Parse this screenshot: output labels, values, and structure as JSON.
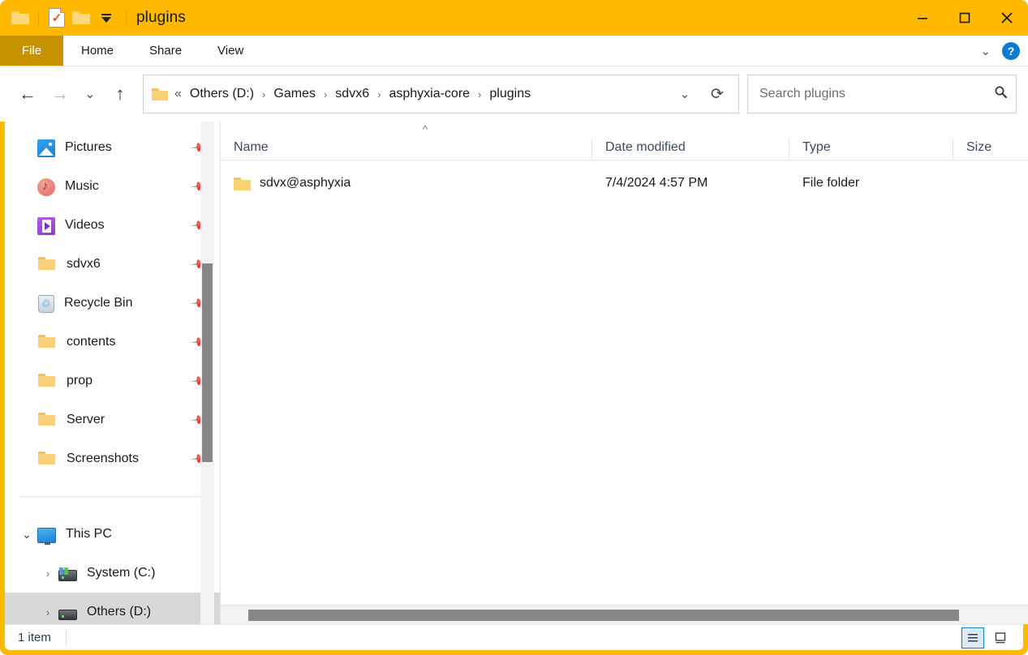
{
  "window": {
    "title": "plugins",
    "controls": {
      "minimize": "minimize-button",
      "maximize": "maximize-button",
      "close": "close-button"
    },
    "accent_color": "#FFB900",
    "file_tab_color": "#C69200"
  },
  "quick_access": {
    "items": [
      {
        "name": "folder-icon",
        "label": ""
      },
      {
        "name": "properties-icon",
        "label": ""
      },
      {
        "name": "new-folder-icon",
        "label": ""
      },
      {
        "name": "customize-dropdown",
        "label": ""
      }
    ]
  },
  "ribbon": {
    "tabs": [
      {
        "label": "File",
        "active": true
      },
      {
        "label": "Home",
        "active": false
      },
      {
        "label": "Share",
        "active": false
      },
      {
        "label": "View",
        "active": false
      }
    ],
    "expand_icon": "chevron-down-icon",
    "help_label": "?"
  },
  "navigation": {
    "back": "←",
    "forward": "→",
    "recent": "⌄",
    "up": "↑",
    "ellipsis": "«",
    "breadcrumbs": [
      "Others (D:)",
      "Games",
      "sdvx6",
      "asphyxia-core",
      "plugins"
    ],
    "separator": "›",
    "dropdown": "⌄",
    "refresh": "⟳"
  },
  "search": {
    "placeholder": "Search plugins",
    "value": "",
    "icon": "search-icon"
  },
  "sidebar": {
    "quick_items": [
      {
        "label": "Pictures",
        "icon": "pictures-icon",
        "pinned": true
      },
      {
        "label": "Music",
        "icon": "music-icon",
        "pinned": true
      },
      {
        "label": "Videos",
        "icon": "videos-icon",
        "pinned": true
      },
      {
        "label": "sdvx6",
        "icon": "folder-icon",
        "pinned": true
      },
      {
        "label": "Recycle Bin",
        "icon": "recycle-bin-icon",
        "pinned": true
      },
      {
        "label": "contents",
        "icon": "folder-icon",
        "pinned": true
      },
      {
        "label": "prop",
        "icon": "folder-icon",
        "pinned": true
      },
      {
        "label": "Server",
        "icon": "folder-icon",
        "pinned": true
      },
      {
        "label": "Screenshots",
        "icon": "folder-icon",
        "pinned": true
      }
    ],
    "tree_items": [
      {
        "label": "This PC",
        "icon": "this-pc-icon",
        "caret": "⌄",
        "expanded": true,
        "selected": false
      },
      {
        "label": "System (C:)",
        "icon": "drive-system-icon",
        "caret": "›",
        "expanded": false,
        "selected": false
      },
      {
        "label": "Others (D:)",
        "icon": "drive-others-icon",
        "caret": "›",
        "expanded": false,
        "selected": true
      }
    ],
    "pin_glyph": "📌"
  },
  "file_list": {
    "sort_indicator": "^",
    "columns": [
      {
        "label": "Name"
      },
      {
        "label": "Date modified"
      },
      {
        "label": "Type"
      },
      {
        "label": "Size"
      }
    ],
    "rows": [
      {
        "name": "sdvx@asphyxia",
        "date_modified": "7/4/2024 4:57 PM",
        "type": "File folder",
        "size": "",
        "icon": "folder-icon"
      }
    ]
  },
  "status": {
    "item_count": "1 item",
    "views": [
      {
        "name": "details-view",
        "active": true
      },
      {
        "name": "large-icons-view",
        "active": false
      }
    ]
  }
}
